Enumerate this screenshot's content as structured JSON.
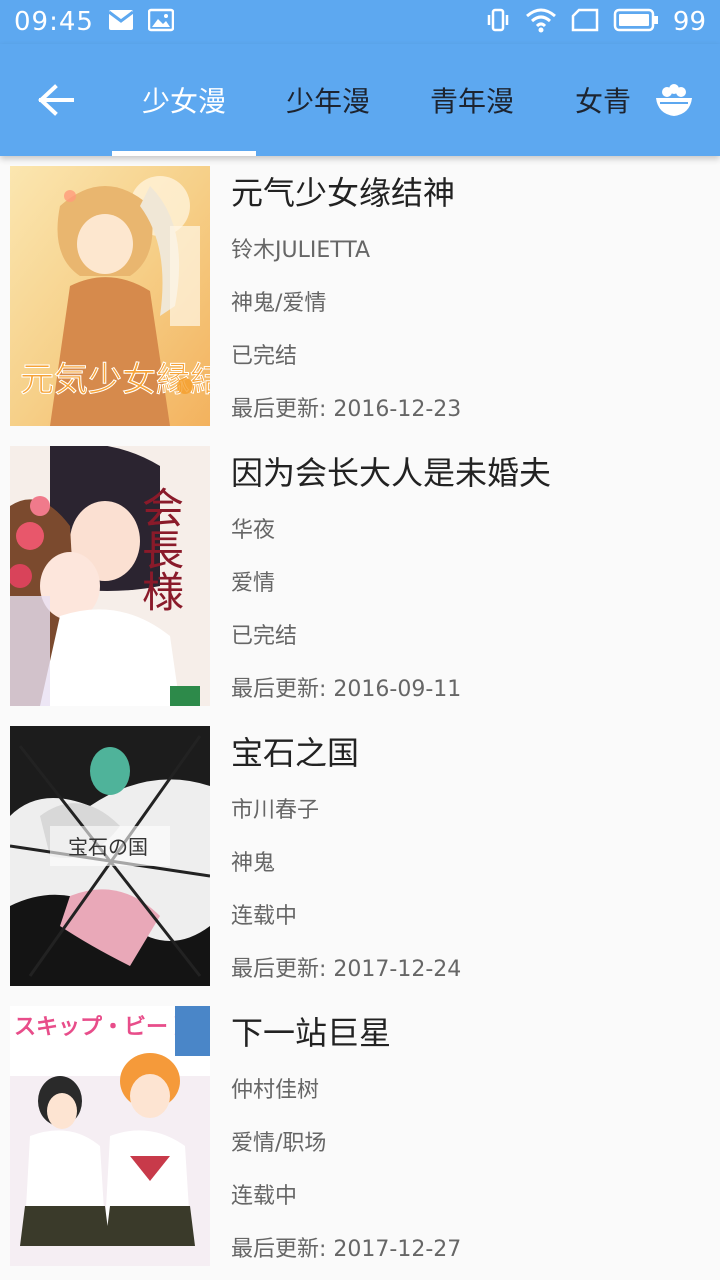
{
  "status": {
    "time": "09:45",
    "battery": "99"
  },
  "toolbar": {
    "tabs": [
      {
        "label": "少女漫",
        "active": true
      },
      {
        "label": "少年漫",
        "active": false
      },
      {
        "label": "青年漫",
        "active": false
      },
      {
        "label": "女青",
        "active": false
      }
    ]
  },
  "colors": {
    "primary": "#5da8f0",
    "active_tab": "#ffffff",
    "inactive_tab": "#1d2430"
  },
  "comics": [
    {
      "title": "元气少女缘结神",
      "author": "铃木JULIETTA",
      "genre": "神鬼/爱情",
      "status": "已完结",
      "updated": "最后更新: 2016-12-23",
      "cover_text": "元気少女縁結神"
    },
    {
      "title": "因为会长大人是未婚夫",
      "author": "华夜",
      "genre": "爱情",
      "status": "已完结",
      "updated": "最后更新: 2016-09-11",
      "cover_text": "会長様"
    },
    {
      "title": "宝石之国",
      "author": "市川春子",
      "genre": "神鬼",
      "status": "连载中",
      "updated": "最后更新: 2017-12-24",
      "cover_text": "宝石の国"
    },
    {
      "title": "下一站巨星",
      "author": "仲村佳树",
      "genre": "爱情/职场",
      "status": "连载中",
      "updated": "最后更新: 2017-12-27",
      "cover_text": "スキップ・ビート!"
    }
  ]
}
